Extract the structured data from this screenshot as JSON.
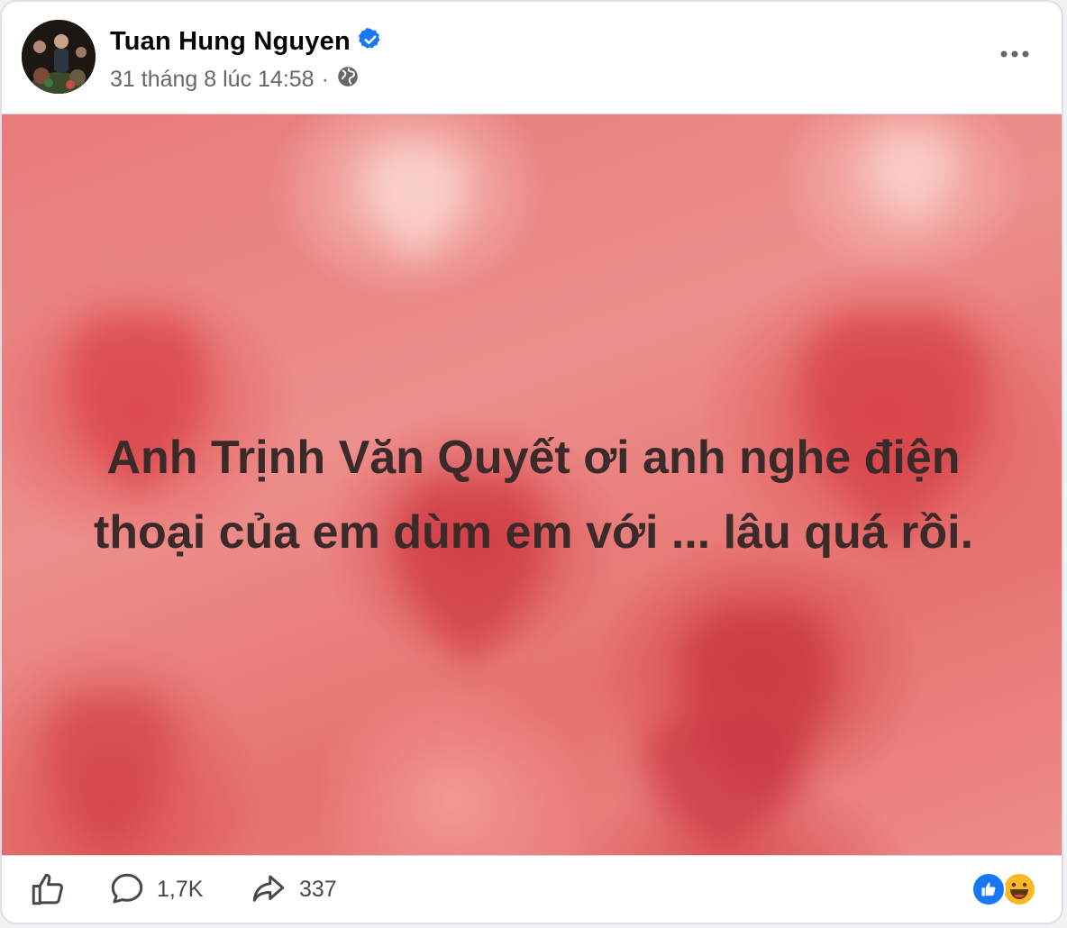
{
  "post": {
    "author": "Tuan Hung Nguyen",
    "timestamp": "31 tháng 8 lúc 14:58",
    "privacy_icon": "globe-icon",
    "verified_icon": "verified-badge-icon",
    "text_line_1": "Anh Trịnh Văn Quyết ơi anh nghe điện",
    "text_line_2": "thoại của em dùm em với ... lâu quá rồi.",
    "background": "pink hearts"
  },
  "actions": {
    "like_icon": "like-icon",
    "comment_icon": "comment-icon",
    "comment_count": "1,7K",
    "share_icon": "share-icon",
    "share_count": "337"
  },
  "reactions": [
    "like",
    "haha"
  ],
  "colors": {
    "verified": "#1877f2",
    "like_reaction": "#1877f2",
    "haha_reaction": "#f7b928",
    "text_primary": "#050505",
    "text_secondary": "#65676b",
    "post_text": "#3b2a2a"
  }
}
